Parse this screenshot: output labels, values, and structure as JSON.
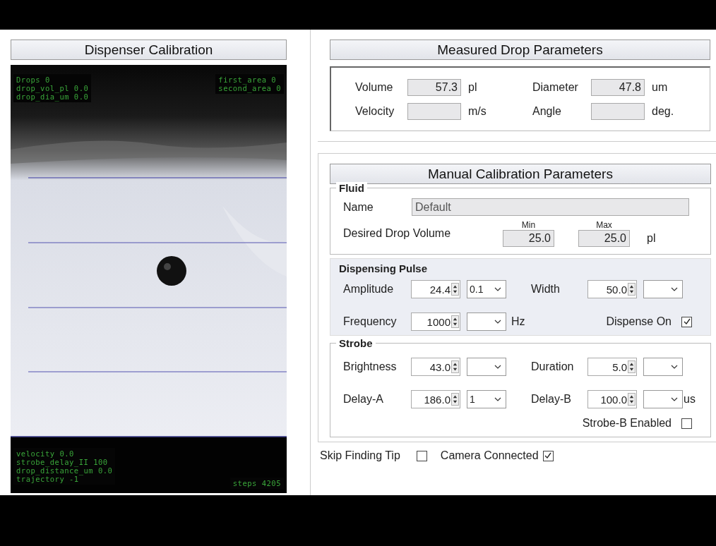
{
  "calibration_view": {
    "title": "Dispenser Calibration",
    "overlay_top_left": [
      "Drops 0",
      "drop_vol_pl 0.0",
      "drop_dia_um 0.0"
    ],
    "overlay_top_right": [
      "first_area 0",
      "second_area 0"
    ],
    "overlay_bottom_left": [
      "velocity 0.0",
      "strobe_delay_II 100",
      "drop_distance_um 0.0",
      "trajectory -1"
    ],
    "overlay_bottom_right": "steps 4205"
  },
  "measured": {
    "title": "Measured Drop Parameters",
    "fields": [
      {
        "label": "Volume",
        "value": "57.3",
        "unit": "pl"
      },
      {
        "label": "Diameter",
        "value": "47.8",
        "unit": "um"
      },
      {
        "label": "Velocity",
        "unit": "m/s"
      },
      {
        "label": "Angle",
        "unit": "deg."
      }
    ]
  },
  "manual": {
    "title": "Manual Calibration Parameters",
    "fluid": {
      "title": "Fluid",
      "name_label": "Name",
      "name_value": "Default",
      "volume_label": "Desired Drop Volume",
      "min_label": "Min",
      "min_value": "25.0",
      "max_label": "Max",
      "max_value": "25.0",
      "unit": "pl"
    },
    "pulse": {
      "title": "Dispensing Pulse",
      "rows": [
        [
          {
            "label": "Amplitude",
            "value": "24.4",
            "step": "0.1"
          },
          {
            "label": "Width",
            "value": "50.0"
          }
        ],
        [
          {
            "label": "Frequency",
            "value": "1000",
            "unit": "Hz"
          }
        ]
      ],
      "checkbox": {
        "label": "Dispense On",
        "checked": true
      }
    },
    "strobe": {
      "title": "Strobe",
      "rows": [
        [
          {
            "label": "Brightness",
            "value": "43.0"
          },
          {
            "label": "Duration",
            "value": "5.0"
          }
        ],
        [
          {
            "label": "Delay-A",
            "value": "186.0",
            "step": "1"
          },
          {
            "label": "Delay-B",
            "value": "100.0",
            "unit": "us"
          }
        ]
      ],
      "checkbox": {
        "label": "Strobe-B Enabled",
        "checked": false
      }
    }
  },
  "footer": [
    {
      "label": "Skip Finding Tip",
      "checked": false
    },
    {
      "label": "Camera Connected",
      "checked": true
    }
  ]
}
